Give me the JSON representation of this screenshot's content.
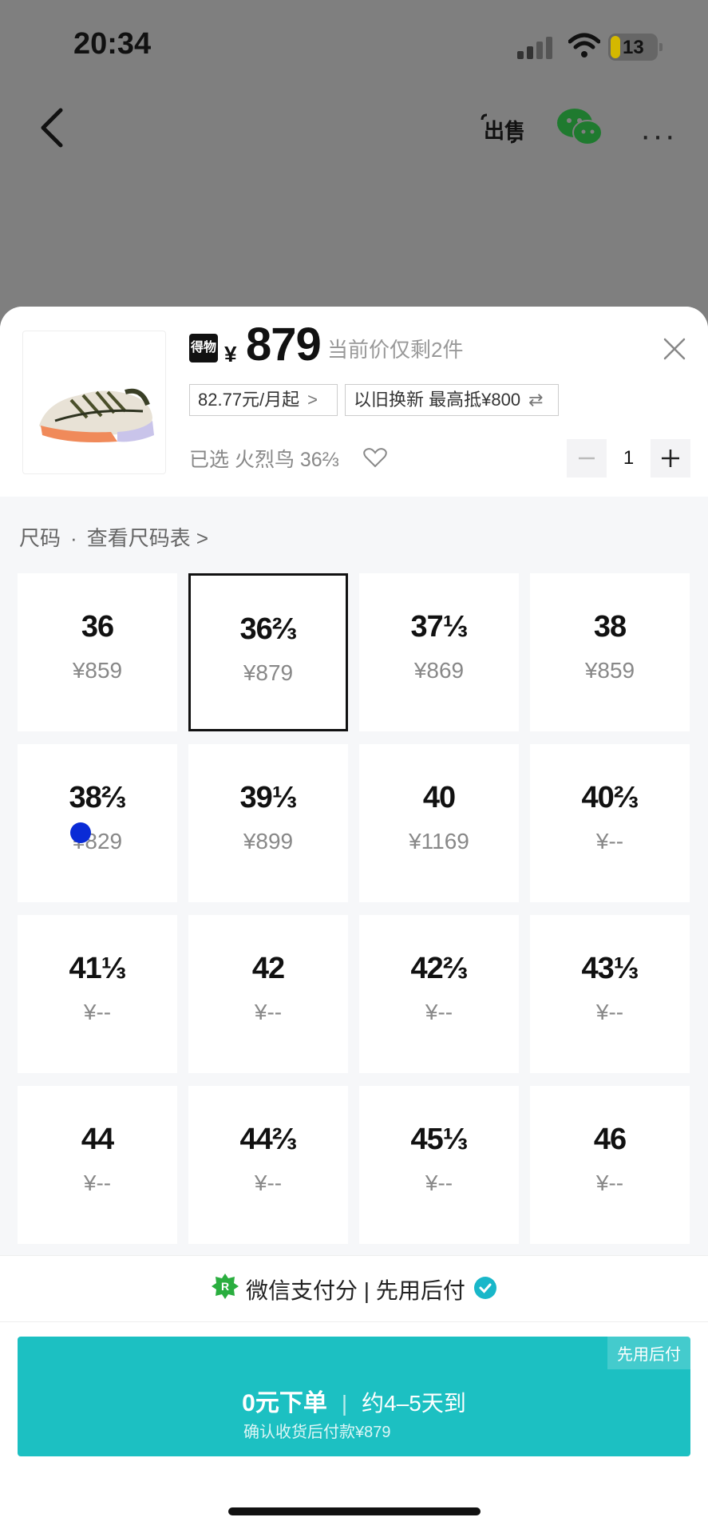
{
  "status_bar": {
    "time": "20:34",
    "battery": "13"
  },
  "top_nav": {
    "sell_label": "出售",
    "more": "···"
  },
  "product": {
    "logo_text": "得物",
    "currency": "¥",
    "price": "879",
    "stock_note": "当前价仅剩2件",
    "installment": "82.77元/月起",
    "tradein": "以旧换新 最高抵¥800",
    "selected": "已选 火烈鸟 36⅔",
    "quantity": "1"
  },
  "size_section": {
    "label": "尺码",
    "chart_link": "查看尺码表 >"
  },
  "sizes": [
    {
      "size": "36",
      "price": "¥859"
    },
    {
      "size": "36⅔",
      "price": "¥879"
    },
    {
      "size": "37⅓",
      "price": "¥869"
    },
    {
      "size": "38",
      "price": "¥859"
    },
    {
      "size": "38⅔",
      "price": "¥829"
    },
    {
      "size": "39⅓",
      "price": "¥899"
    },
    {
      "size": "40",
      "price": "¥1169"
    },
    {
      "size": "40⅔",
      "price": "¥--"
    },
    {
      "size": "41⅓",
      "price": "¥--"
    },
    {
      "size": "42",
      "price": "¥--"
    },
    {
      "size": "42⅔",
      "price": "¥--"
    },
    {
      "size": "43⅓",
      "price": "¥--"
    },
    {
      "size": "44",
      "price": "¥--"
    },
    {
      "size": "44⅔",
      "price": "¥--"
    },
    {
      "size": "45⅓",
      "price": "¥--"
    },
    {
      "size": "46",
      "price": "¥--"
    }
  ],
  "selected_size_index": 1,
  "payment": {
    "label": "微信支付分 | 先用后付"
  },
  "cta": {
    "tag": "先用后付",
    "main": "0元下单",
    "delivery": "约4–5天到",
    "sub": "确认收货后付款¥879"
  },
  "colors": {
    "accent": "#1cc0c2",
    "check": "#19b7c9",
    "wechat_green": "#2aae3f"
  }
}
